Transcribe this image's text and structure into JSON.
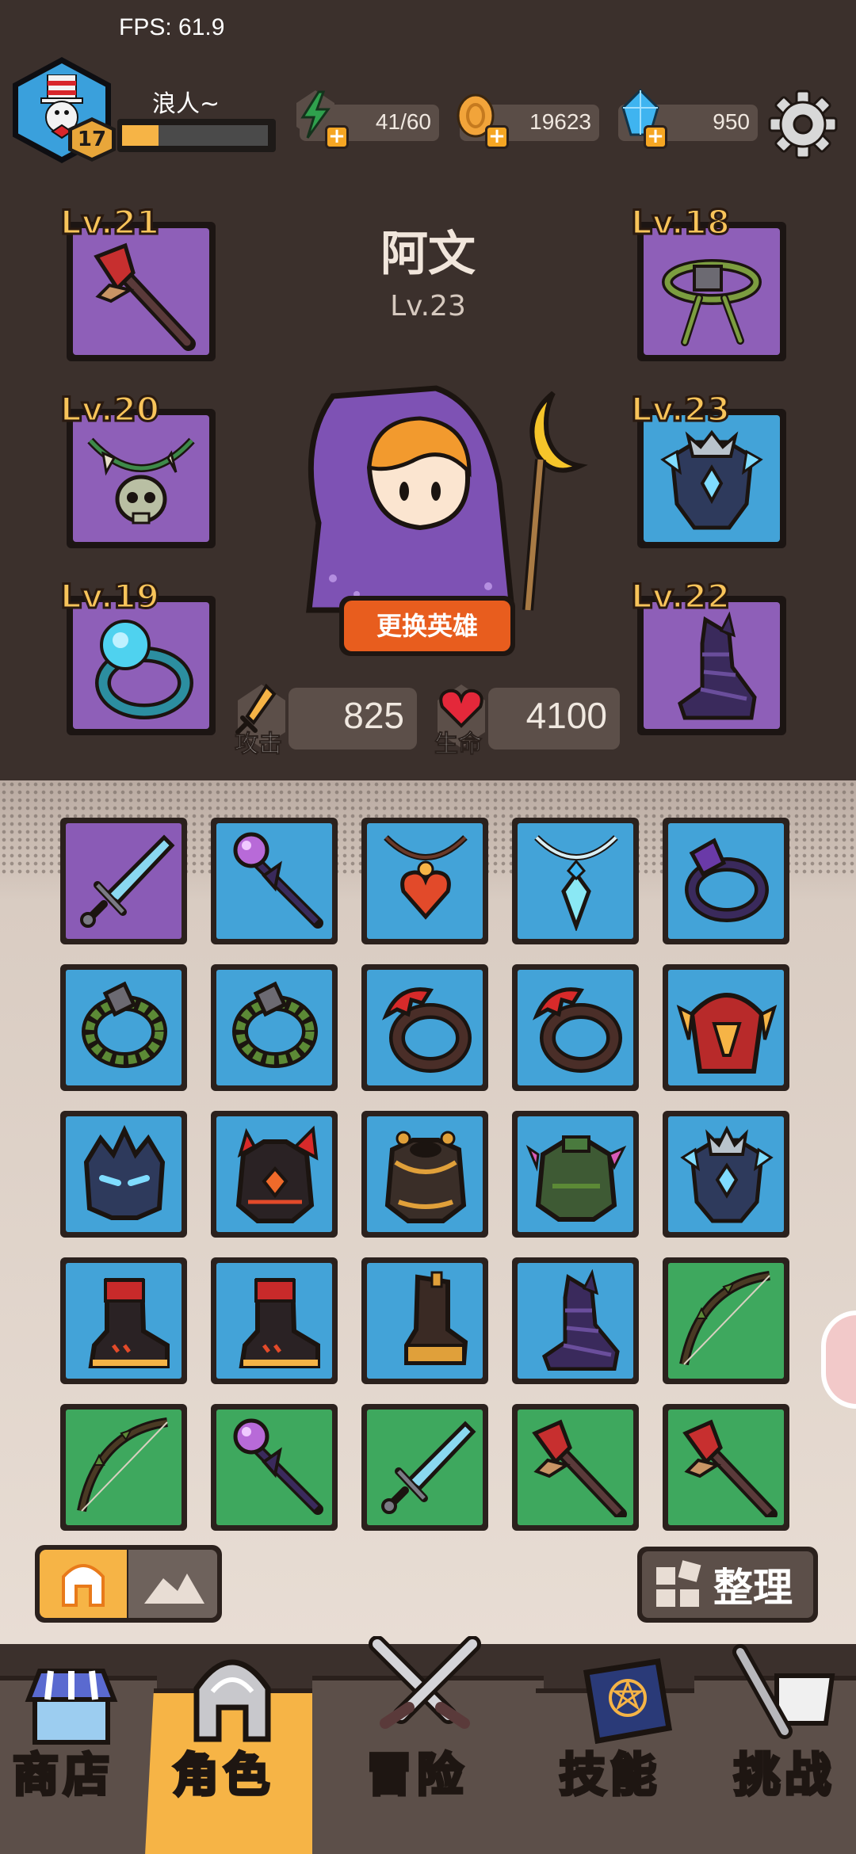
{
  "fps": "FPS: 61.9",
  "player": {
    "name": "浪人~",
    "level": "17",
    "xp_fraction": 0.25
  },
  "resources": [
    {
      "name": "energy",
      "value": "41/60",
      "icon": "lightning-icon"
    },
    {
      "name": "coins",
      "value": "19623",
      "icon": "coin-icon"
    },
    {
      "name": "gems",
      "value": "950",
      "icon": "gem-icon"
    }
  ],
  "hero": {
    "name": "阿文",
    "level": "Lv.23",
    "change_button": "更换英雄"
  },
  "stats": {
    "attack_label": "攻击",
    "attack_value": "825",
    "hp_label": "生命",
    "hp_value": "4100"
  },
  "equipped": [
    {
      "slot": "weapon",
      "level": "Lv.21",
      "icon": "staff-icon"
    },
    {
      "slot": "necklace",
      "level": "Lv.20",
      "icon": "skull-necklace-icon"
    },
    {
      "slot": "ring",
      "level": "Lv.19",
      "icon": "ring-icon"
    },
    {
      "slot": "belt",
      "level": "Lv.18",
      "icon": "vine-belt-icon"
    },
    {
      "slot": "armor",
      "level": "Lv.23",
      "icon": "crystal-armor-icon"
    },
    {
      "slot": "boots",
      "level": "Lv.22",
      "icon": "shadow-boots-icon"
    }
  ],
  "inventory": [
    {
      "rarity": "purple",
      "icon": "sword-icon"
    },
    {
      "rarity": "blue",
      "icon": "orb-staff-icon"
    },
    {
      "rarity": "blue",
      "icon": "heart-pendant-icon"
    },
    {
      "rarity": "blue",
      "icon": "crystal-pendant-icon"
    },
    {
      "rarity": "blue",
      "icon": "ring-icon"
    },
    {
      "rarity": "blue",
      "icon": "vine-ring-icon"
    },
    {
      "rarity": "blue",
      "icon": "vine-ring-icon"
    },
    {
      "rarity": "blue",
      "icon": "fang-ring-icon"
    },
    {
      "rarity": "blue",
      "icon": "fang-ring-icon"
    },
    {
      "rarity": "blue",
      "icon": "horned-helmet-icon"
    },
    {
      "rarity": "blue",
      "icon": "dark-helmet-icon"
    },
    {
      "rarity": "blue",
      "icon": "lava-armor-icon"
    },
    {
      "rarity": "blue",
      "icon": "bronze-armor-icon"
    },
    {
      "rarity": "blue",
      "icon": "spiked-armor-icon"
    },
    {
      "rarity": "blue",
      "icon": "crystal-armor-icon"
    },
    {
      "rarity": "blue",
      "icon": "flame-boots-icon"
    },
    {
      "rarity": "blue",
      "icon": "flame-boots-icon"
    },
    {
      "rarity": "blue",
      "icon": "leather-boots-icon"
    },
    {
      "rarity": "blue",
      "icon": "shadow-boots-icon"
    },
    {
      "rarity": "green",
      "icon": "bow-icon"
    },
    {
      "rarity": "green",
      "icon": "bow-icon"
    },
    {
      "rarity": "green",
      "icon": "orb-staff-icon"
    },
    {
      "rarity": "green",
      "icon": "sword-icon"
    },
    {
      "rarity": "green",
      "icon": "staff-icon"
    },
    {
      "rarity": "green",
      "icon": "staff-icon"
    }
  ],
  "sort_button": "整理",
  "filter_tabs": [
    "helmet-filter-icon",
    "material-filter-icon"
  ],
  "nav": [
    {
      "label": "商店",
      "icon": "shop-icon"
    },
    {
      "label": "角色",
      "icon": "helmet-icon",
      "active": true
    },
    {
      "label": "冒险",
      "icon": "crossed-swords-icon"
    },
    {
      "label": "技能",
      "icon": "spellbook-icon"
    },
    {
      "label": "挑战",
      "icon": "sword-flag-icon"
    }
  ],
  "colors": {
    "background": "#3b302c",
    "accent": "#f6b446",
    "blue_rarity": "#43a3d8",
    "purple_rarity": "#8a5bb6",
    "green_rarity": "#3ea85e"
  }
}
